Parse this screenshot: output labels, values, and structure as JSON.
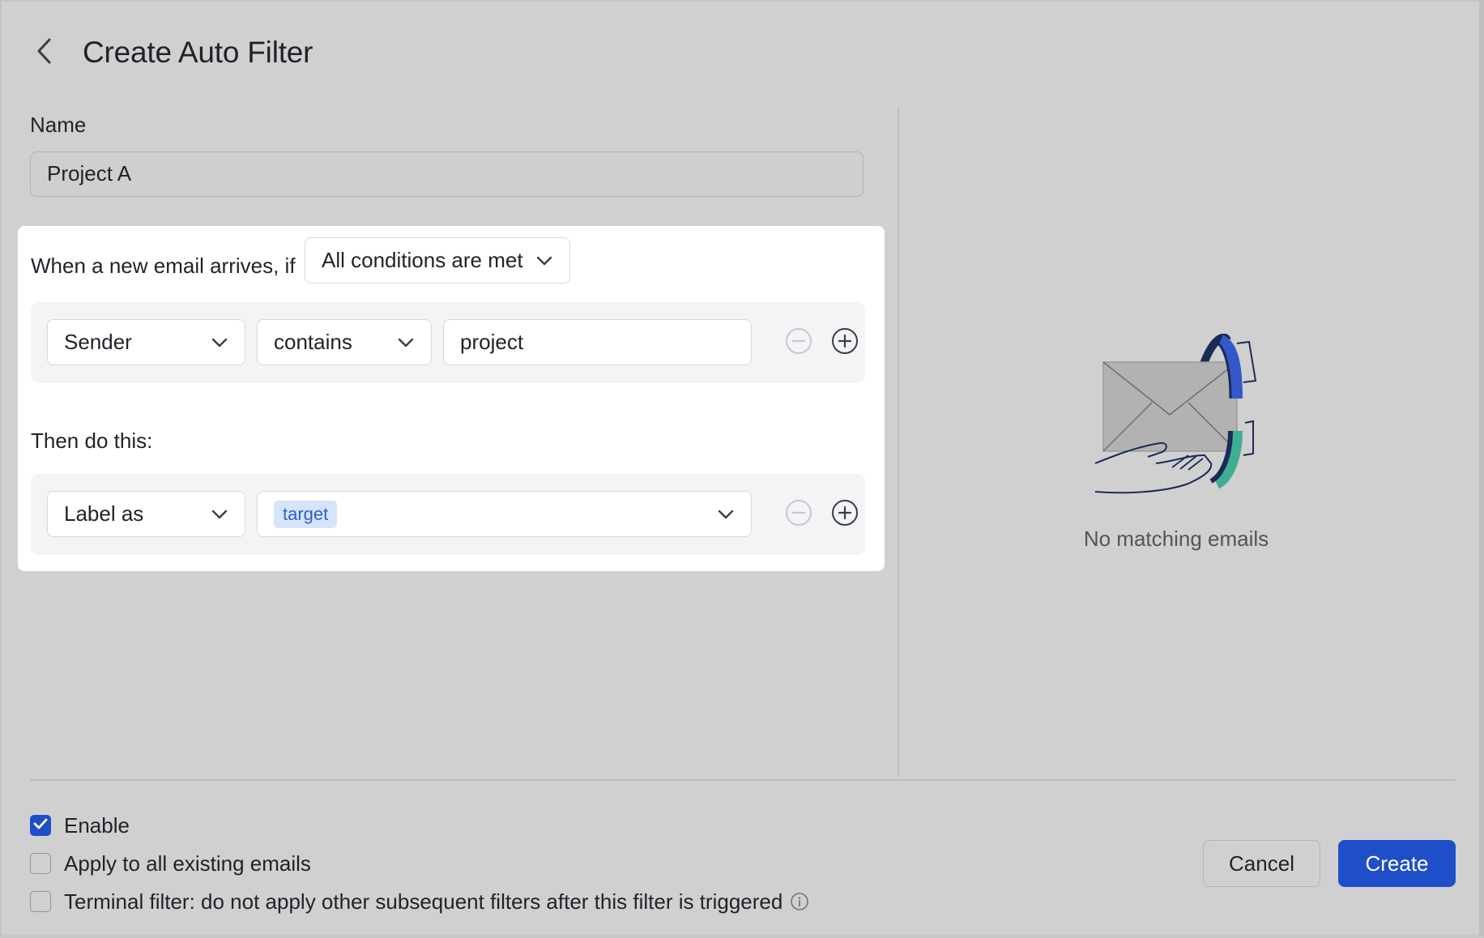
{
  "dialog": {
    "title": "Create Auto Filter",
    "back_icon": "chevron-left-icon"
  },
  "name": {
    "label": "Name",
    "value": "Project A"
  },
  "conditions": {
    "intro": "When a new email arrives, if",
    "match_mode": "All conditions are met",
    "rows": [
      {
        "field": "Sender",
        "operator": "contains",
        "value": "project"
      }
    ]
  },
  "actions": {
    "label": "Then do this:",
    "rows": [
      {
        "action": "Label as",
        "tag": "target"
      }
    ]
  },
  "preview": {
    "empty_text": "No matching emails",
    "illustration_icon": "envelope-hand-icon"
  },
  "options": {
    "enable": {
      "label": "Enable",
      "checked": true
    },
    "apply_existing": {
      "label": "Apply to all existing emails",
      "checked": false
    },
    "terminal": {
      "label": "Terminal filter: do not apply other subsequent filters after this filter is triggered",
      "checked": false
    }
  },
  "footer": {
    "cancel_label": "Cancel",
    "create_label": "Create"
  },
  "colors": {
    "primary": "#1f4fc8",
    "overlay": "#d0d0d0",
    "tag_bg": "#d6e4fb",
    "tag_text": "#2f5fd0",
    "accent_teal": "#3fae93"
  }
}
